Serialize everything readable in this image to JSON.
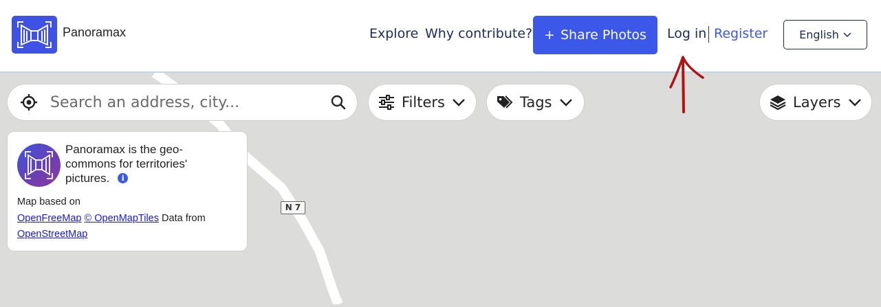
{
  "header": {
    "brand": "Panoramax",
    "nav": {
      "explore": "Explore",
      "why_contribute": "Why contribute?",
      "share_photos": "Share Photos",
      "share_plus": "+",
      "login": "Log in",
      "register": "Register"
    },
    "language": "English"
  },
  "toolbar": {
    "search_placeholder": "Search an address, city...",
    "filters": "Filters",
    "tags": "Tags",
    "layers": "Layers"
  },
  "info_card": {
    "title": "Panoramax is the geo-commons for territories' pictures.",
    "info_icon": "i",
    "map_based_on": "Map based on",
    "openfreemap": "OpenFreeMap",
    "openmaptiles": "© OpenMapTiles",
    "data_from": "Data from",
    "openstreetmap": "OpenStreetMap"
  },
  "map": {
    "road_label": "N 7"
  },
  "colors": {
    "accent": "#3b58e8",
    "nav_text": "#1c2c5a",
    "map_bg": "#dcdcda",
    "annotation": "#b01515"
  }
}
